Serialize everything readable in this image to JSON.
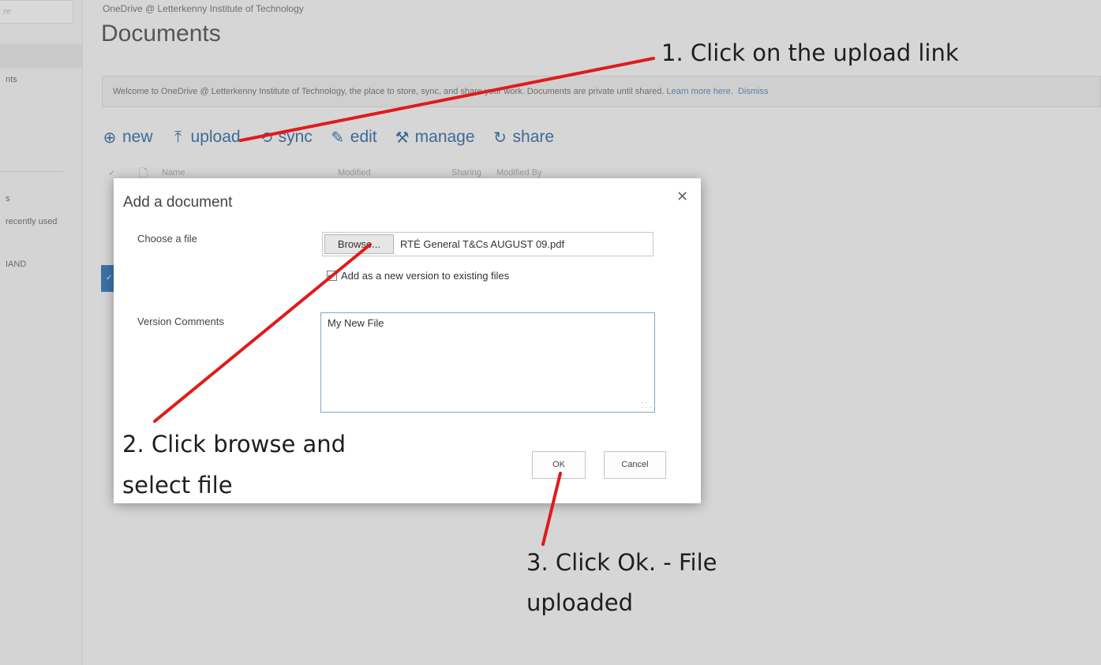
{
  "sidebar": {
    "search_fragment": "re",
    "items": [
      "nts",
      "s",
      "recently used",
      "IAND"
    ]
  },
  "header": {
    "site_name": "OneDrive @ Letterkenny Institute of Technology",
    "title": "Documents"
  },
  "welcome": {
    "text": "Welcome to OneDrive @ Letterkenny Institute of Technology, the place to store, sync, and share your work. Documents are private until shared.",
    "learn_more": "Learn more here.",
    "dismiss": "Dismiss"
  },
  "commands": [
    {
      "label": "new",
      "icon": "plus-circle-icon"
    },
    {
      "label": "upload",
      "icon": "upload-arrow-icon"
    },
    {
      "label": "sync",
      "icon": "sync-icon"
    },
    {
      "label": "edit",
      "icon": "pencil-icon"
    },
    {
      "label": "manage",
      "icon": "wrench-icon"
    },
    {
      "label": "share",
      "icon": "share-icon"
    }
  ],
  "columns": [
    "Name",
    "Modified",
    "Sharing",
    "Modified By"
  ],
  "dialog": {
    "title": "Add a document",
    "choose_label": "Choose a file",
    "browse_label": "Browse...",
    "file_name": "RTÉ General T&Cs AUGUST 09.pdf",
    "checkbox_label": "Add as a new version to existing files",
    "checkbox_checked": true,
    "comments_label": "Version Comments",
    "comments_value": "My New File",
    "ok_label": "OK",
    "cancel_label": "Cancel"
  },
  "annotations": {
    "step1": "1. Click on the upload link",
    "step2_line1": "2. Click browse and",
    "step2_line2": "select file",
    "step3_line1": "3. Click Ok. - File",
    "step3_line2": "uploaded",
    "arrow_color": "#e01b1b"
  },
  "colors": {
    "link_blue": "#3d6a96",
    "overlay_gray": "#d6d6d6"
  }
}
